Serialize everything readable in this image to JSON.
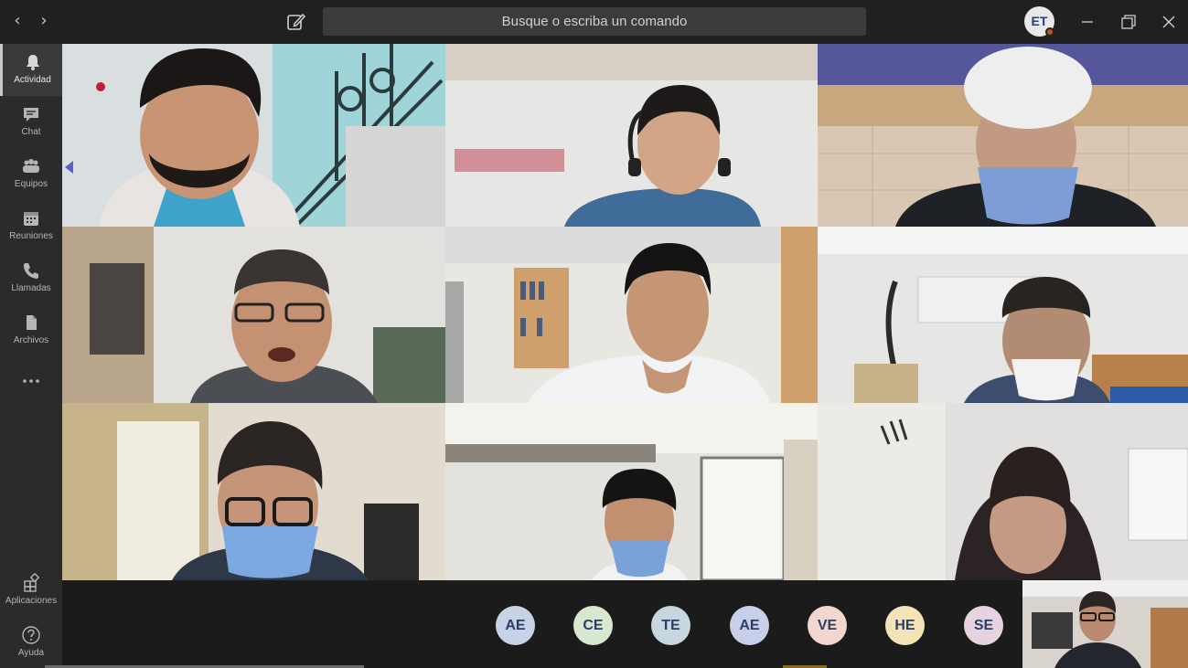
{
  "titlebar": {
    "search_placeholder": "Busque o escriba un comando",
    "user_initials": "ET"
  },
  "rail": {
    "items": [
      {
        "label": "Actividad",
        "icon": "bell-icon"
      },
      {
        "label": "Chat",
        "icon": "chat-icon"
      },
      {
        "label": "Equipos",
        "icon": "teams-icon"
      },
      {
        "label": "Reuniones",
        "icon": "calendar-icon"
      },
      {
        "label": "Llamadas",
        "icon": "phone-icon"
      },
      {
        "label": "Archivos",
        "icon": "file-icon"
      },
      {
        "label": "Aplicaciones",
        "icon": "apps-icon"
      },
      {
        "label": "Ayuda",
        "icon": "help-icon"
      }
    ]
  },
  "participants": [
    {
      "initials": "AE",
      "color": "#c7d2e6"
    },
    {
      "initials": "CE",
      "color": "#d9e6d0"
    },
    {
      "initials": "TE",
      "color": "#c8d6e0"
    },
    {
      "initials": "AE",
      "color": "#c7d0e8"
    },
    {
      "initials": "VE",
      "color": "#f3d6d0"
    },
    {
      "initials": "HE",
      "color": "#f5e3b8"
    },
    {
      "initials": "SE",
      "color": "#e6d3df"
    }
  ],
  "colors": {
    "app_bg": "#1f1f1f",
    "rail_bg": "#2b2b2b",
    "search_bg": "#3b3b3b",
    "presence_busy": "#cc4a31"
  }
}
